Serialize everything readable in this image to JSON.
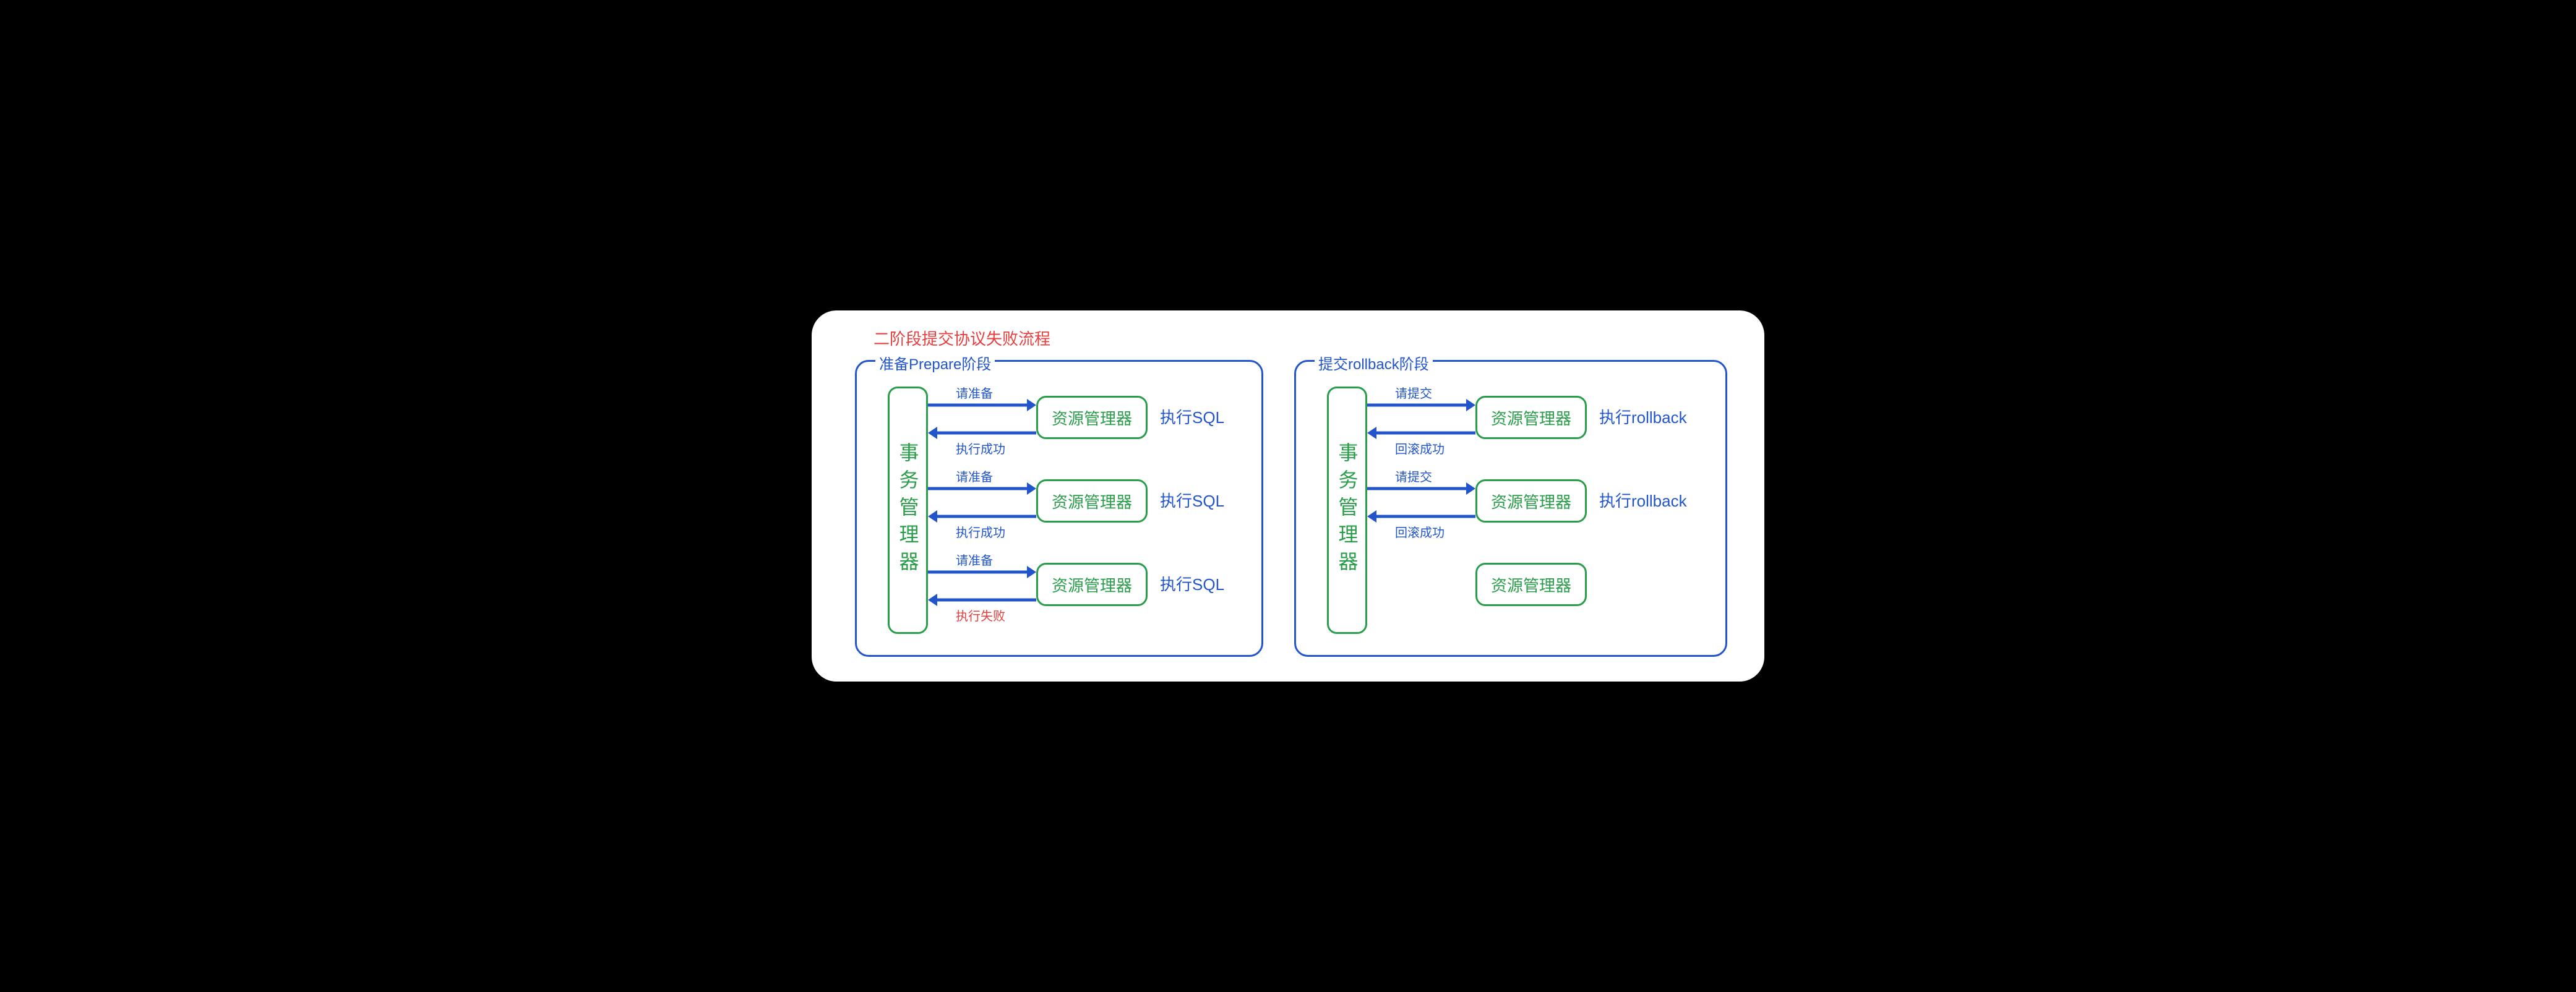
{
  "title": "二阶段提交协议失败流程",
  "left_phase": {
    "label": "准备Prepare阶段",
    "tm": "事务管理器",
    "rows": [
      {
        "rm": "资源管理器",
        "side": "执行SQL",
        "top_label": "请准备",
        "bottom_label": "执行成功",
        "bottom_red": false
      },
      {
        "rm": "资源管理器",
        "side": "执行SQL",
        "top_label": "请准备",
        "bottom_label": "执行成功",
        "bottom_red": false
      },
      {
        "rm": "资源管理器",
        "side": "执行SQL",
        "top_label": "请准备",
        "bottom_label": "执行失败",
        "bottom_red": true
      }
    ]
  },
  "right_phase": {
    "label": "提交rollback阶段",
    "tm": "事务管理器",
    "rows": [
      {
        "rm": "资源管理器",
        "side": "执行rollback",
        "top_label": "请提交",
        "bottom_label": "回滚成功",
        "has_arrows": true
      },
      {
        "rm": "资源管理器",
        "side": "执行rollback",
        "top_label": "请提交",
        "bottom_label": "回滚成功",
        "has_arrows": true
      },
      {
        "rm": "资源管理器",
        "side": "",
        "top_label": "",
        "bottom_label": "",
        "has_arrows": false
      }
    ]
  }
}
